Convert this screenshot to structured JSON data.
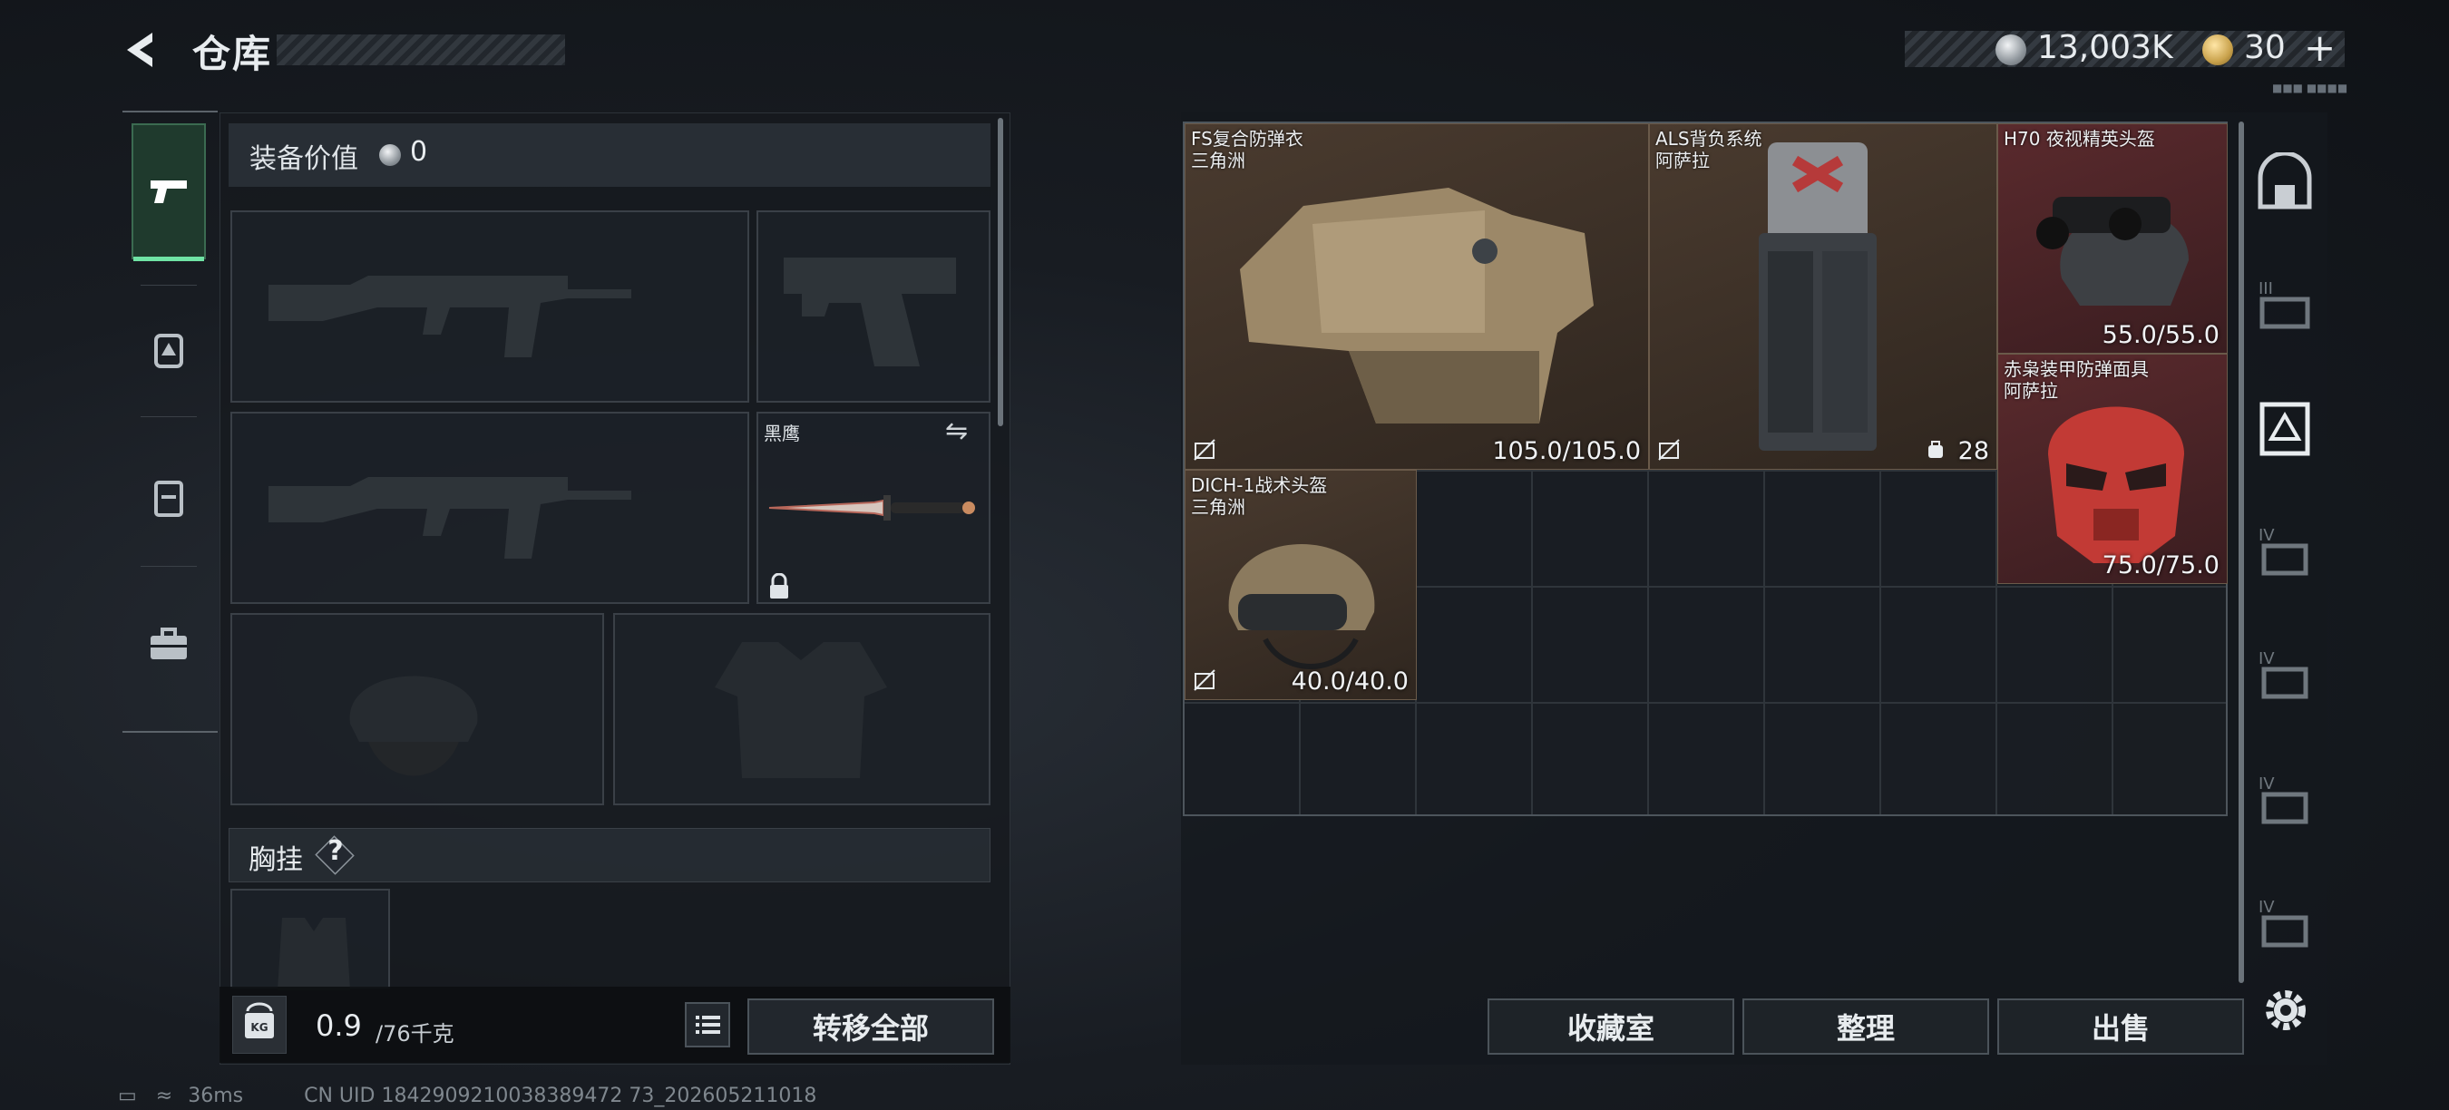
{
  "header": {
    "title": "仓库"
  },
  "currency": {
    "silver": "13,003K",
    "gold": "30",
    "add": "+",
    "tiny": "■■■ ■■■■"
  },
  "left": {
    "equip_label": "装备价值",
    "equip_value": "0",
    "knife_name": "黑鹰",
    "chest_label": "胸挂",
    "help": "?",
    "weight_value": "0.9",
    "weight_max": "/76千克",
    "weight_icon_label": "KG",
    "transfer_all": "转移全部"
  },
  "items": [
    {
      "name": "FS复合防弹衣",
      "origin": "三角洲",
      "durability": "105.0/105.0"
    },
    {
      "name": "ALS背负系统",
      "origin": "阿萨拉",
      "count": "28"
    },
    {
      "name": "H70 夜视精英头盔",
      "durability": "55.0/55.0"
    },
    {
      "name": "赤枭装甲防弹面具",
      "origin": "阿萨拉",
      "durability": "75.0/75.0"
    },
    {
      "name": "DICH-1战术头盔",
      "origin": "三角洲",
      "durability": "40.0/40.0"
    }
  ],
  "right_tabs": [
    "home-shelf",
    "tier-III",
    "tier-IV-selected",
    "tier-IV",
    "tier-IV",
    "tier-IV",
    "tier-IV"
  ],
  "actions": {
    "collection": "收藏室",
    "sort": "整理",
    "sell": "出售"
  },
  "status": {
    "ping": "36ms",
    "uid": "CN UID 1842909210038389472 73_202605211018"
  }
}
